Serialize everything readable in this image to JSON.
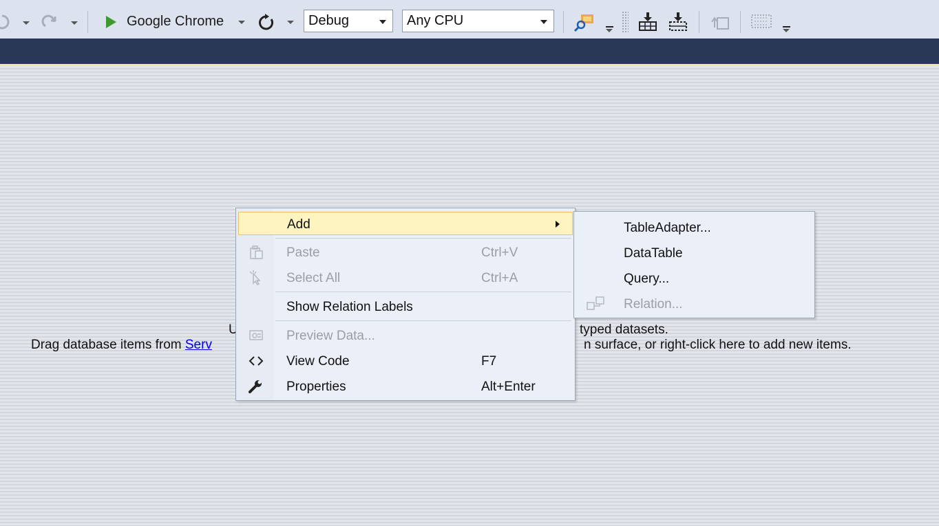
{
  "toolbar": {
    "run_target": "Google Chrome",
    "configuration": "Debug",
    "platform": "Any CPU",
    "icons": [
      "undo-icon",
      "redo-icon",
      "start-icon",
      "refresh-icon",
      "find-icon",
      "add-table-icon",
      "add-query-icon",
      "relation-icon",
      "layout-icon"
    ]
  },
  "surface": {
    "hint_line1_start": "U",
    "hint_line1_end": "typed datasets.",
    "hint_line2_start": "Drag database items from ",
    "hint_link": "Serv",
    "hint_line2_end": "n surface, or right-click here to add new items."
  },
  "context_menu": {
    "items": [
      {
        "label": "Add",
        "shortcut": "",
        "icon": "",
        "enabled": true,
        "highlighted": true,
        "submenu": true
      },
      {
        "label": "Paste",
        "shortcut": "Ctrl+V",
        "icon": "paste-icon",
        "enabled": false
      },
      {
        "label": "Select All",
        "shortcut": "Ctrl+A",
        "icon": "select-all-icon",
        "enabled": false
      },
      {
        "label": "Show Relation Labels",
        "shortcut": "",
        "icon": "",
        "enabled": true
      },
      {
        "label": "Preview Data...",
        "shortcut": "",
        "icon": "preview-data-icon",
        "enabled": false
      },
      {
        "label": "View Code",
        "shortcut": "F7",
        "icon": "code-icon",
        "enabled": true
      },
      {
        "label": "Properties",
        "shortcut": "Alt+Enter",
        "icon": "wrench-icon",
        "enabled": true
      }
    ]
  },
  "add_submenu": {
    "items": [
      {
        "label": "TableAdapter...",
        "enabled": true
      },
      {
        "label": "DataTable",
        "enabled": true
      },
      {
        "label": "Query...",
        "enabled": true
      },
      {
        "label": "Relation...",
        "enabled": false,
        "icon": "relation-icon"
      }
    ]
  },
  "colors": {
    "band": "#293955",
    "menu_bg": "#eaeff8",
    "highlight": "#fdf4bf",
    "disabled_text": "#9a9ea7",
    "link": "#0000ee"
  }
}
